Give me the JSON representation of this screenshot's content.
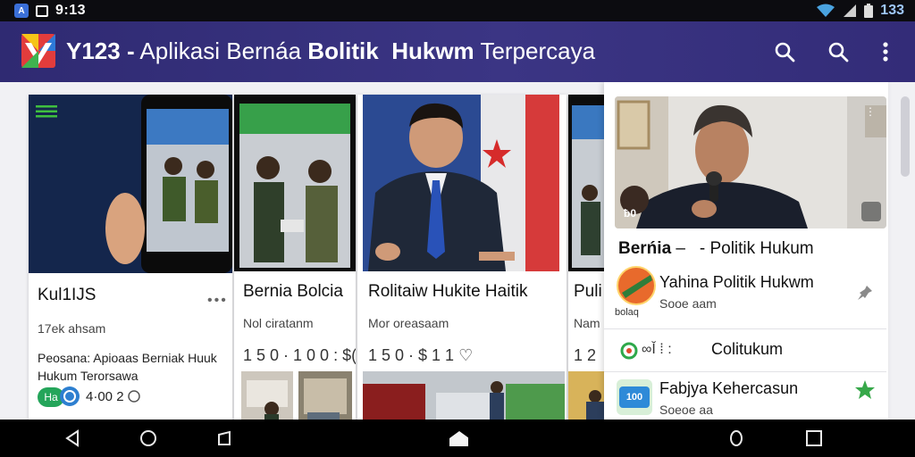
{
  "status_bar": {
    "time": "9:13",
    "app_icon": "accessibility-icon",
    "icons": [
      "wifi-icon",
      "signal-icon",
      "battery-icon"
    ],
    "right_value": "133"
  },
  "app_bar": {
    "title_prefix": "Y123 -",
    "title_normal": "Aplikasi Bernáa",
    "title_bold_1": "Bolitik",
    "title_bold_2": "Hukwm",
    "title_suffix": "Terpercaya",
    "icons": [
      "search-icon",
      "search-icon",
      "more-vert-icon"
    ]
  },
  "cards": [
    {
      "title": "Kul1IJS",
      "subtitle": "17ek ahsam",
      "body_line_1": "Peosana: Apioaas Berniak Huuk",
      "body_line_2": "Hukum Terorsawa",
      "badge": "Ha",
      "stat": "4·00 2"
    },
    {
      "title": "Bernia Bolcia",
      "subtitle": "Nol ciratanm",
      "meta": "1 5 0  · 1 0 0  : $("
    },
    {
      "title": "Rolitaiw Hukite Haitik",
      "subtitle": "Mor oreasaam",
      "meta": "1 5 0  · $ 1 1 ♡"
    },
    {
      "title": "Puli",
      "subtitle": "Nam",
      "meta": "1 2"
    }
  ],
  "side_panel": {
    "header_title": "Berńia",
    "header_suffix": "Politik Hukum",
    "dash_1": "–",
    "dash_2": "-",
    "thumb_label": "ƀ0",
    "items": [
      {
        "title": "Yahina Politik Hukwm",
        "subtitle": "Sooe aam",
        "avatar_label": "bolaq"
      },
      {
        "prefix": "∞Ǐ ⁞ :",
        "title": "Colitukum"
      },
      {
        "title": "Fabjya Kehercasun",
        "subtitle": "Soeoe aa",
        "avatar_label": "100"
      }
    ]
  },
  "nav_bar": {
    "icons": [
      "back-icon",
      "home-icon",
      "recents-icon",
      "home-house-icon",
      "circle-icon",
      "square-icon"
    ]
  },
  "colors": {
    "app_bar": "#332d79",
    "status_bar": "#0c0c10",
    "accent_green": "#2ea84a",
    "star_green": "#37a84a"
  }
}
